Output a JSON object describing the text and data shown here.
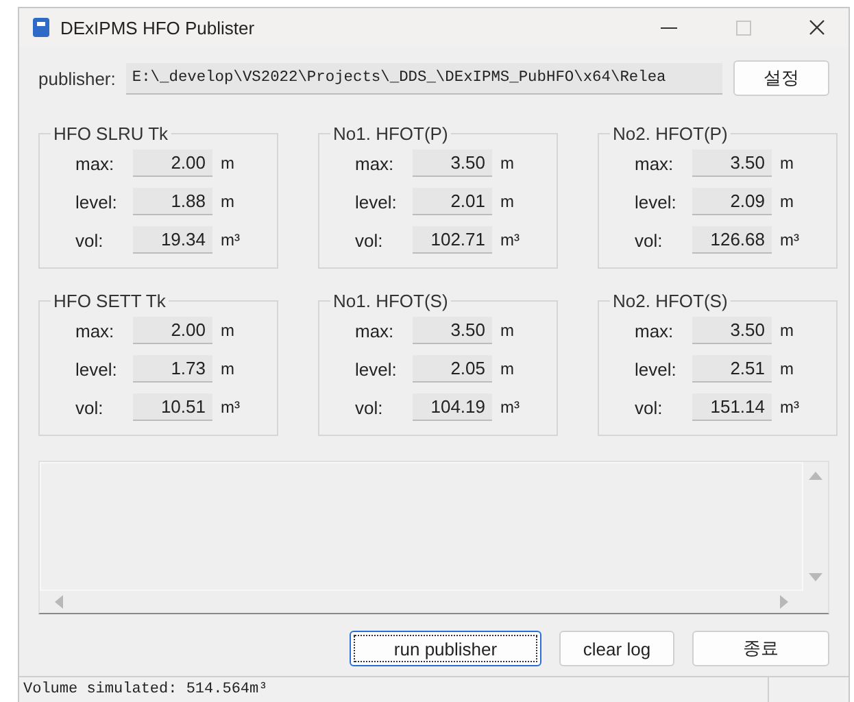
{
  "window": {
    "title": "DExIPMS HFO Publister"
  },
  "publisher": {
    "label": "publisher:",
    "value": "E:\\_develop\\VS2022\\Projects\\_DDS_\\DExIPMS_PubHFO\\x64\\Relea",
    "button": "설정"
  },
  "tanks": [
    {
      "title": "HFO SLRU Tk",
      "rows": [
        {
          "label": "max:",
          "value": "2.00",
          "unit": "m"
        },
        {
          "label": "level:",
          "value": "1.88",
          "unit": "m"
        },
        {
          "label": "vol:",
          "value": "19.34",
          "unit": "m³"
        }
      ]
    },
    {
      "title": "No1. HFOT(P)",
      "rows": [
        {
          "label": "max:",
          "value": "3.50",
          "unit": "m"
        },
        {
          "label": "level:",
          "value": "2.01",
          "unit": "m"
        },
        {
          "label": "vol:",
          "value": "102.71",
          "unit": "m³"
        }
      ]
    },
    {
      "title": "No2. HFOT(P)",
      "rows": [
        {
          "label": "max:",
          "value": "3.50",
          "unit": "m"
        },
        {
          "label": "level:",
          "value": "2.09",
          "unit": "m"
        },
        {
          "label": "vol:",
          "value": "126.68",
          "unit": "m³"
        }
      ]
    },
    {
      "title": "HFO SETT Tk",
      "rows": [
        {
          "label": "max:",
          "value": "2.00",
          "unit": "m"
        },
        {
          "label": "level:",
          "value": "1.73",
          "unit": "m"
        },
        {
          "label": "vol:",
          "value": "10.51",
          "unit": "m³"
        }
      ]
    },
    {
      "title": "No1. HFOT(S)",
      "rows": [
        {
          "label": "max:",
          "value": "3.50",
          "unit": "m"
        },
        {
          "label": "level:",
          "value": "2.05",
          "unit": "m"
        },
        {
          "label": "vol:",
          "value": "104.19",
          "unit": "m³"
        }
      ]
    },
    {
      "title": "No2. HFOT(S)",
      "rows": [
        {
          "label": "max:",
          "value": "3.50",
          "unit": "m"
        },
        {
          "label": "level:",
          "value": "2.51",
          "unit": "m"
        },
        {
          "label": "vol:",
          "value": "151.14",
          "unit": "m³"
        }
      ]
    }
  ],
  "buttons": [
    {
      "label": "run publisher",
      "focused": true
    },
    {
      "label": "clear log",
      "focused": false
    },
    {
      "label": "종료",
      "focused": false
    }
  ],
  "status_bar": "Volume simulated: 514.564m³"
}
